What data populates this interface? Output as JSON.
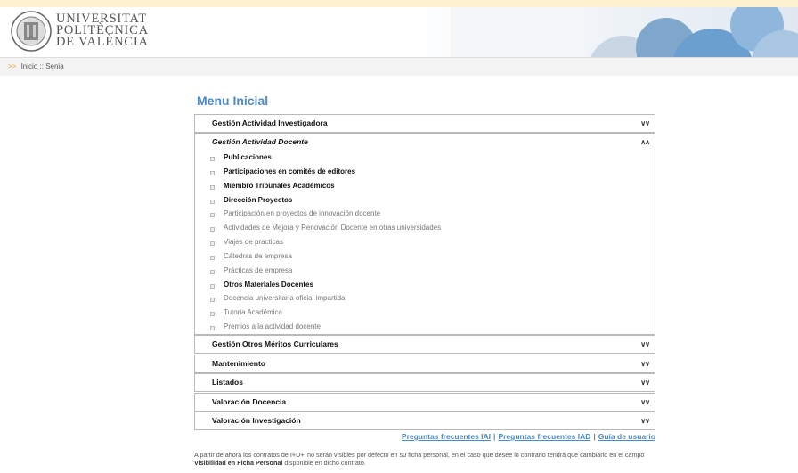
{
  "header": {
    "logo_lines": [
      "UNIVERSITAT",
      "POLITÈCNICA",
      "DE VALÈNCIA"
    ]
  },
  "breadcrumb": {
    "arrow": ">>",
    "home": "Inicio",
    "separator": "::",
    "current": "Senia"
  },
  "main": {
    "title": "Menu Inicial"
  },
  "sections": [
    {
      "label": "Gestión Actividad Investigadora",
      "chevron": "»"
    },
    {
      "label": "Gestión Actividad Docente",
      "chevron": "«",
      "items": [
        {
          "label": "Publicaciones"
        },
        {
          "label": "Participaciones en comités de editores"
        },
        {
          "label": "Miembro Tribunales Académicos"
        },
        {
          "label": "Dirección Proyectos"
        },
        {
          "label": "Participación en proyectos de innovación docente"
        },
        {
          "label": "Actividades de Mejora y Renovación Docente en otras universidades"
        },
        {
          "label": "Viajes de practicas"
        },
        {
          "label": "Cátedras de empresa"
        },
        {
          "label": "Prácticas de empresa"
        },
        {
          "label": "Otros Materiales Docentes"
        },
        {
          "label": "Docencia universitaria oficial impartida"
        },
        {
          "label": "Tutoria Académica"
        },
        {
          "label": "Premios a la actividad docente"
        }
      ]
    },
    {
      "label": "Gestión Otros Méritos Curriculares",
      "chevron": "»"
    },
    {
      "label": "Mantenimiento",
      "chevron": "»"
    },
    {
      "label": "Listados",
      "chevron": "»"
    },
    {
      "label": "Valoración Docencia",
      "chevron": "»"
    },
    {
      "label": "Valoración Investigación",
      "chevron": "»"
    }
  ],
  "footer_links": {
    "faq_iai": "Preguntas frecuentes IAI",
    "faq_iad": "Preguntas frecuentes IAD",
    "guide": "Guía de usuario",
    "separator": "|"
  },
  "notice": {
    "text_1": "A partir de ahora los contratos de I+D+i no serán visibles por defecto en su ficha personal, en el caso que desee lo contrario tendrá que cambiarlo en el campo ",
    "bold": "Visibilidad en Ficha Personal",
    "text_2": " disponible en dicho contrato."
  }
}
